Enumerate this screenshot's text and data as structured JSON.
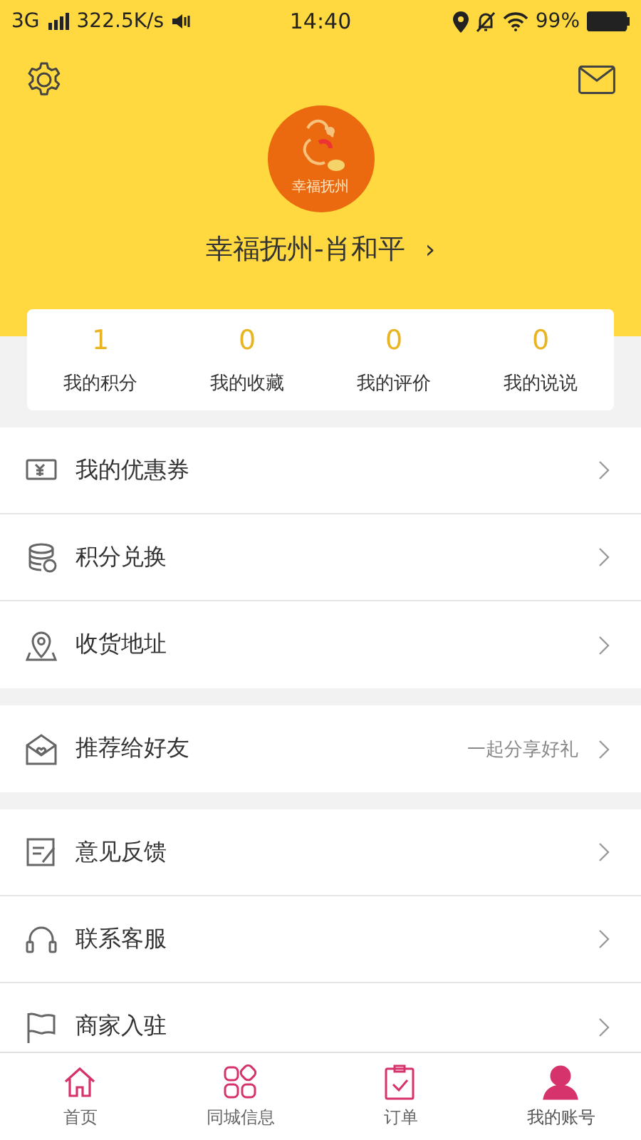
{
  "status_bar": {
    "network": "3G",
    "speed": "322.5K/s",
    "time": "14:40",
    "battery": "99%"
  },
  "profile": {
    "avatar_text": "幸福抚州",
    "name": "幸福抚州-肖和平",
    "arrow": "›"
  },
  "stats": [
    {
      "value": "1",
      "label": "我的积分"
    },
    {
      "value": "0",
      "label": "我的收藏"
    },
    {
      "value": "0",
      "label": "我的评价"
    },
    {
      "value": "0",
      "label": "我的说说"
    }
  ],
  "menu_groups": [
    {
      "items": [
        {
          "label": "我的优惠券"
        },
        {
          "label": "积分兑换"
        },
        {
          "label": "收货地址"
        }
      ]
    },
    {
      "items": [
        {
          "label": "推荐给好友",
          "hint": "一起分享好礼"
        }
      ]
    },
    {
      "items": [
        {
          "label": "意见反馈"
        },
        {
          "label": "联系客服"
        },
        {
          "label": "商家入驻"
        }
      ]
    }
  ],
  "tab_bar": [
    {
      "label": "首页",
      "selected": false
    },
    {
      "label": "同城信息",
      "selected": false
    },
    {
      "label": "订单",
      "selected": false
    },
    {
      "label": "我的账号",
      "selected": true
    }
  ]
}
